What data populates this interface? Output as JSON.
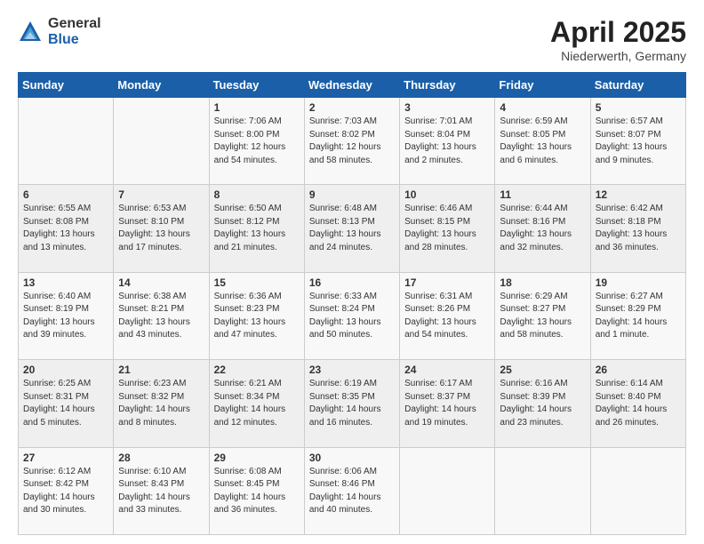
{
  "logo": {
    "general": "General",
    "blue": "Blue"
  },
  "title": "April 2025",
  "location": "Niederwerth, Germany",
  "days_header": [
    "Sunday",
    "Monday",
    "Tuesday",
    "Wednesday",
    "Thursday",
    "Friday",
    "Saturday"
  ],
  "weeks": [
    [
      {
        "day": "",
        "info": ""
      },
      {
        "day": "",
        "info": ""
      },
      {
        "day": "1",
        "info": "Sunrise: 7:06 AM\nSunset: 8:00 PM\nDaylight: 12 hours\nand 54 minutes."
      },
      {
        "day": "2",
        "info": "Sunrise: 7:03 AM\nSunset: 8:02 PM\nDaylight: 12 hours\nand 58 minutes."
      },
      {
        "day": "3",
        "info": "Sunrise: 7:01 AM\nSunset: 8:04 PM\nDaylight: 13 hours\nand 2 minutes."
      },
      {
        "day": "4",
        "info": "Sunrise: 6:59 AM\nSunset: 8:05 PM\nDaylight: 13 hours\nand 6 minutes."
      },
      {
        "day": "5",
        "info": "Sunrise: 6:57 AM\nSunset: 8:07 PM\nDaylight: 13 hours\nand 9 minutes."
      }
    ],
    [
      {
        "day": "6",
        "info": "Sunrise: 6:55 AM\nSunset: 8:08 PM\nDaylight: 13 hours\nand 13 minutes."
      },
      {
        "day": "7",
        "info": "Sunrise: 6:53 AM\nSunset: 8:10 PM\nDaylight: 13 hours\nand 17 minutes."
      },
      {
        "day": "8",
        "info": "Sunrise: 6:50 AM\nSunset: 8:12 PM\nDaylight: 13 hours\nand 21 minutes."
      },
      {
        "day": "9",
        "info": "Sunrise: 6:48 AM\nSunset: 8:13 PM\nDaylight: 13 hours\nand 24 minutes."
      },
      {
        "day": "10",
        "info": "Sunrise: 6:46 AM\nSunset: 8:15 PM\nDaylight: 13 hours\nand 28 minutes."
      },
      {
        "day": "11",
        "info": "Sunrise: 6:44 AM\nSunset: 8:16 PM\nDaylight: 13 hours\nand 32 minutes."
      },
      {
        "day": "12",
        "info": "Sunrise: 6:42 AM\nSunset: 8:18 PM\nDaylight: 13 hours\nand 36 minutes."
      }
    ],
    [
      {
        "day": "13",
        "info": "Sunrise: 6:40 AM\nSunset: 8:19 PM\nDaylight: 13 hours\nand 39 minutes."
      },
      {
        "day": "14",
        "info": "Sunrise: 6:38 AM\nSunset: 8:21 PM\nDaylight: 13 hours\nand 43 minutes."
      },
      {
        "day": "15",
        "info": "Sunrise: 6:36 AM\nSunset: 8:23 PM\nDaylight: 13 hours\nand 47 minutes."
      },
      {
        "day": "16",
        "info": "Sunrise: 6:33 AM\nSunset: 8:24 PM\nDaylight: 13 hours\nand 50 minutes."
      },
      {
        "day": "17",
        "info": "Sunrise: 6:31 AM\nSunset: 8:26 PM\nDaylight: 13 hours\nand 54 minutes."
      },
      {
        "day": "18",
        "info": "Sunrise: 6:29 AM\nSunset: 8:27 PM\nDaylight: 13 hours\nand 58 minutes."
      },
      {
        "day": "19",
        "info": "Sunrise: 6:27 AM\nSunset: 8:29 PM\nDaylight: 14 hours\nand 1 minute."
      }
    ],
    [
      {
        "day": "20",
        "info": "Sunrise: 6:25 AM\nSunset: 8:31 PM\nDaylight: 14 hours\nand 5 minutes."
      },
      {
        "day": "21",
        "info": "Sunrise: 6:23 AM\nSunset: 8:32 PM\nDaylight: 14 hours\nand 8 minutes."
      },
      {
        "day": "22",
        "info": "Sunrise: 6:21 AM\nSunset: 8:34 PM\nDaylight: 14 hours\nand 12 minutes."
      },
      {
        "day": "23",
        "info": "Sunrise: 6:19 AM\nSunset: 8:35 PM\nDaylight: 14 hours\nand 16 minutes."
      },
      {
        "day": "24",
        "info": "Sunrise: 6:17 AM\nSunset: 8:37 PM\nDaylight: 14 hours\nand 19 minutes."
      },
      {
        "day": "25",
        "info": "Sunrise: 6:16 AM\nSunset: 8:39 PM\nDaylight: 14 hours\nand 23 minutes."
      },
      {
        "day": "26",
        "info": "Sunrise: 6:14 AM\nSunset: 8:40 PM\nDaylight: 14 hours\nand 26 minutes."
      }
    ],
    [
      {
        "day": "27",
        "info": "Sunrise: 6:12 AM\nSunset: 8:42 PM\nDaylight: 14 hours\nand 30 minutes."
      },
      {
        "day": "28",
        "info": "Sunrise: 6:10 AM\nSunset: 8:43 PM\nDaylight: 14 hours\nand 33 minutes."
      },
      {
        "day": "29",
        "info": "Sunrise: 6:08 AM\nSunset: 8:45 PM\nDaylight: 14 hours\nand 36 minutes."
      },
      {
        "day": "30",
        "info": "Sunrise: 6:06 AM\nSunset: 8:46 PM\nDaylight: 14 hours\nand 40 minutes."
      },
      {
        "day": "",
        "info": ""
      },
      {
        "day": "",
        "info": ""
      },
      {
        "day": "",
        "info": ""
      }
    ]
  ]
}
